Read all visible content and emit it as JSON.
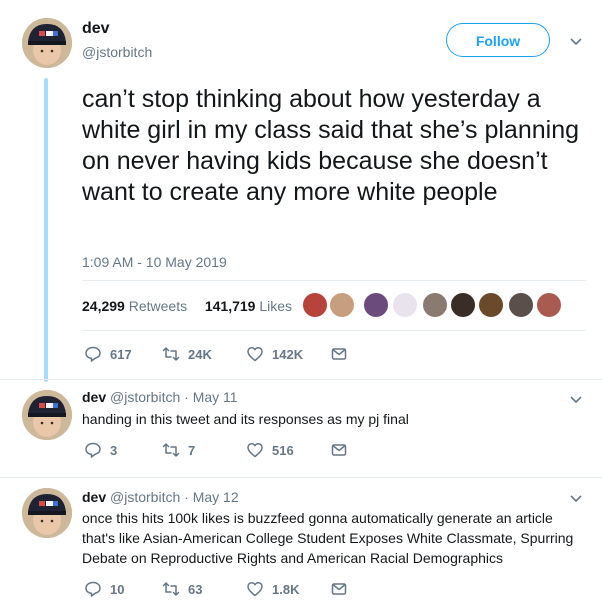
{
  "main_tweet": {
    "display_name": "dev",
    "handle": "@jstorbitch",
    "follow_label": "Follow",
    "text": "can’t stop thinking about how yesterday a white girl in my class said that she’s planning on never having kids because she doesn’t want to create any more white people",
    "timestamp": "1:09 AM - 10 May 2019",
    "retweets_count": "24,299",
    "retweets_label": "Retweets",
    "likes_count": "141,719",
    "likes_label": "Likes",
    "actions": {
      "replies": "617",
      "retweets": "24K",
      "likes": "142K"
    }
  },
  "replies": [
    {
      "display_name": "dev",
      "handle": "@jstorbitch",
      "date": "· May 11",
      "text": "handing in this tweet and its responses as my pj final",
      "actions": {
        "replies": "3",
        "retweets": "7",
        "likes": "516"
      }
    },
    {
      "display_name": "dev",
      "handle": "@jstorbitch",
      "date": "· May 12",
      "text": "once this hits 100k likes is buzzfeed gonna automatically generate an article that's like Asian-American College Student Exposes White Classmate, Spurring Debate on Reproductive Rights and American Racial Demographics",
      "actions": {
        "replies": "10",
        "retweets": "63",
        "likes": "1.8K"
      }
    }
  ],
  "colors": {
    "accent": "#1da1f2",
    "thread_line": "#a9dbff",
    "muted": "#657786"
  },
  "icons": [
    "reply-icon",
    "retweet-icon",
    "like-icon",
    "dm-icon",
    "chevron-down-icon"
  ]
}
